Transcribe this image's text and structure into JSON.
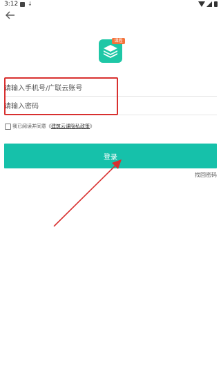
{
  "status_bar": {
    "time": "3:12"
  },
  "logo": {
    "badge": "课程"
  },
  "login_form": {
    "account_placeholder": "请输入手机号/广联云账号",
    "password_placeholder": "请输入密码"
  },
  "agreement": {
    "prefix": "我已阅读并同意《",
    "link_label": "建筑云课隐私政策",
    "suffix": "》"
  },
  "buttons": {
    "login_label": "登录",
    "forgot_password_label": "找回密码"
  },
  "colors": {
    "primary": "#16c1aa",
    "badge": "#f4733b",
    "annotation": "#d8302f"
  },
  "icons": {
    "back": "arrow-left-icon",
    "logo": "layers-book-icon"
  }
}
